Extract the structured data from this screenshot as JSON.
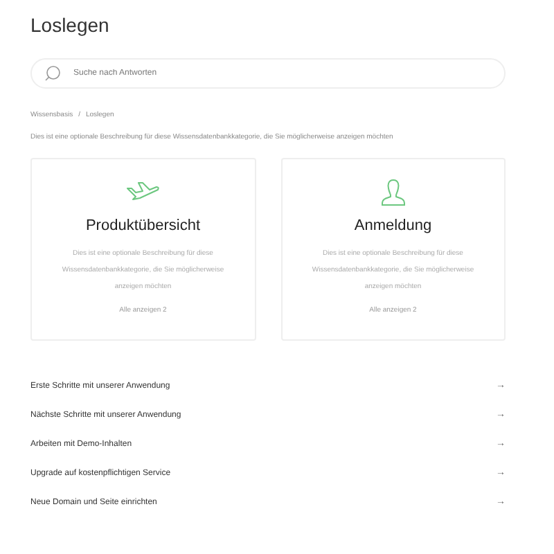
{
  "title": "Loslegen",
  "search": {
    "placeholder": "Suche nach Antworten"
  },
  "breadcrumb": [
    "Wissensbasis",
    "/",
    "Loslegen"
  ],
  "description": "Dies ist eine optionale Beschreibung für diese Wissensdatenbankkategorie, die Sie möglicherweise anzeigen möchten",
  "cards": [
    {
      "title": "Produktübersicht",
      "description": "Dies ist eine optionale Beschreibung für diese Wissensdatenbankkategorie, die Sie möglicherweise anzeigen möchten",
      "link": "Alle anzeigen 2"
    },
    {
      "title": "Anmeldung",
      "description": "Dies ist eine optionale Beschreibung für diese Wissensdatenbankkategorie, die Sie möglicherweise anzeigen möchten",
      "link": "Alle anzeigen 2"
    }
  ],
  "articles": [
    {
      "label": "Erste Schritte mit unserer Anwendung",
      "arrow": "→"
    },
    {
      "label": "Nächste Schritte mit unserer Anwendung",
      "arrow": "→"
    },
    {
      "label": "Arbeiten mit Demo-Inhalten",
      "arrow": "→"
    },
    {
      "label": "Upgrade auf kostenpflichtigen Service",
      "arrow": "→"
    },
    {
      "label": "Neue Domain und Seite einrichten",
      "arrow": "→"
    }
  ]
}
